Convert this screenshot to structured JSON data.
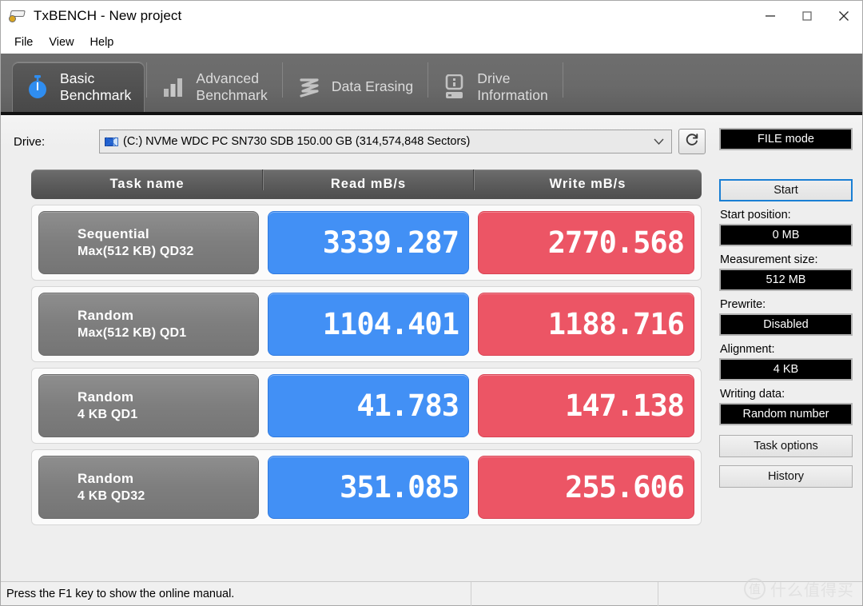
{
  "window": {
    "title": "TxBENCH - New project",
    "app_icon": "drive-app-icon",
    "minimize_label": "─",
    "maximize_label": "□",
    "close_label": "✕"
  },
  "menu": {
    "items": [
      {
        "label": "File"
      },
      {
        "label": "View"
      },
      {
        "label": "Help"
      }
    ]
  },
  "tabs": [
    {
      "label": "Basic\nBenchmark",
      "icon": "stopwatch-icon",
      "active": true
    },
    {
      "label": "Advanced\nBenchmark",
      "icon": "bar-chart-icon",
      "active": false
    },
    {
      "label": "Data Erasing",
      "icon": "scribble-erase-icon",
      "active": false
    },
    {
      "label": "Drive\nInformation",
      "icon": "drive-info-icon",
      "active": false
    }
  ],
  "drive": {
    "label": "Drive:",
    "selected": "(C:) NVMe WDC PC SN730 SDB  150.00 GB (314,574,848 Sectors)",
    "dropdown_icon": "chevron-down-icon",
    "refresh_icon": "refresh-icon"
  },
  "table": {
    "headers": {
      "task": "Task name",
      "read": "Read mB/s",
      "write": "Write mB/s"
    },
    "rows": [
      {
        "task_line1": "Sequential",
        "task_line2": "Max(512 KB) QD32",
        "read": "3339.287",
        "write": "2770.568"
      },
      {
        "task_line1": "Random",
        "task_line2": "Max(512 KB) QD1",
        "read": "1104.401",
        "write": "1188.716"
      },
      {
        "task_line1": "Random",
        "task_line2": "4 KB QD1",
        "read": "41.783",
        "write": "147.138"
      },
      {
        "task_line1": "Random",
        "task_line2": "4 KB QD32",
        "read": "351.085",
        "write": "255.606"
      }
    ]
  },
  "sidebar": {
    "mode_display": "FILE mode",
    "start_button": "Start",
    "start_position_label": "Start position:",
    "start_position_value": "0 MB",
    "measurement_size_label": "Measurement size:",
    "measurement_size_value": "512 MB",
    "prewrite_label": "Prewrite:",
    "prewrite_value": "Disabled",
    "alignment_label": "Alignment:",
    "alignment_value": "4 KB",
    "writing_data_label": "Writing data:",
    "writing_data_value": "Random number",
    "task_options_button": "Task options",
    "history_button": "History"
  },
  "statusbar": {
    "message": "Press the F1 key to show the online manual.",
    "pane2": "",
    "pane3": ""
  },
  "watermark": {
    "mark": "值",
    "text": "什么值得买"
  },
  "colors": {
    "read_cell": "#4290f5",
    "write_cell": "#ec5565",
    "task_cell": "#7e7e7e",
    "tabbar": "#6a6a6a",
    "focus_blue": "#1a7fd4"
  }
}
